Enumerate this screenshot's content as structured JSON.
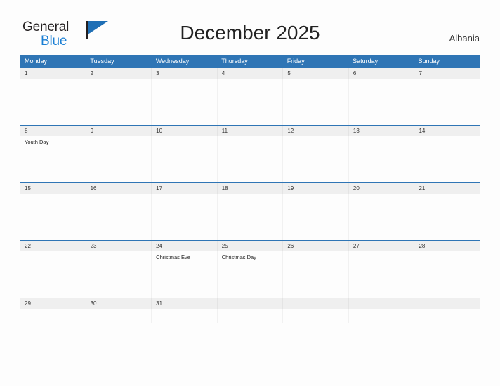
{
  "logo": {
    "word_one": "General",
    "word_two": "Blue",
    "flag_icon": "flag-triangle-icon",
    "accent_color": "#1b7fd4"
  },
  "header": {
    "title": "December 2025",
    "country": "Albania"
  },
  "theme": {
    "header_blue": "#2f75b5",
    "date_band_gray": "#efefef",
    "page_background": "#fdfdfd",
    "text_color": "#222222"
  },
  "calendar": {
    "weekday_headers": [
      "Monday",
      "Tuesday",
      "Wednesday",
      "Thursday",
      "Friday",
      "Saturday",
      "Sunday"
    ],
    "weeks": [
      {
        "dates": [
          "1",
          "2",
          "3",
          "4",
          "5",
          "6",
          "7"
        ],
        "events": [
          [],
          [],
          [],
          [],
          [],
          [],
          []
        ]
      },
      {
        "dates": [
          "8",
          "9",
          "10",
          "11",
          "12",
          "13",
          "14"
        ],
        "events": [
          [
            "Youth Day"
          ],
          [],
          [],
          [],
          [],
          [],
          []
        ]
      },
      {
        "dates": [
          "15",
          "16",
          "17",
          "18",
          "19",
          "20",
          "21"
        ],
        "events": [
          [],
          [],
          [],
          [],
          [],
          [],
          []
        ]
      },
      {
        "dates": [
          "22",
          "23",
          "24",
          "25",
          "26",
          "27",
          "28"
        ],
        "events": [
          [],
          [],
          [
            "Christmas Eve"
          ],
          [
            "Christmas Day"
          ],
          [],
          [],
          []
        ]
      },
      {
        "dates": [
          "29",
          "30",
          "31",
          "",
          "",
          "",
          ""
        ],
        "events": [
          [],
          [],
          [],
          [],
          [],
          [],
          []
        ]
      }
    ]
  }
}
